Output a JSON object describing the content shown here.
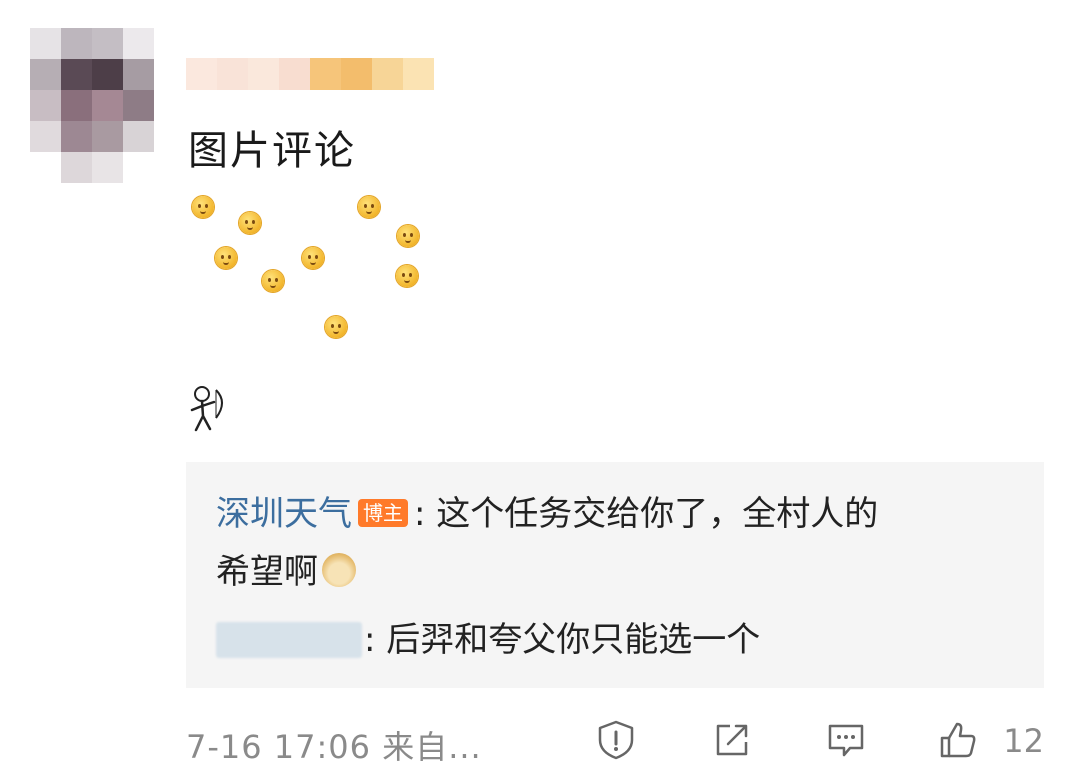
{
  "comment": {
    "text": "图片评论",
    "emoji_icon": "smile-face-icon",
    "sticker_icon": "archer-sticker-icon"
  },
  "reply": {
    "author": "深圳天气",
    "badge": "博主",
    "author_text": ": 这个任务交给你了，全村人的",
    "author_text_line2": "希望啊",
    "reply_text": ": 后羿和夸父你只能选一个"
  },
  "footer": {
    "timestamp": "7-16 17:06 来自...",
    "like_count": "12",
    "icons": [
      "report-icon",
      "share-icon",
      "comment-icon",
      "like-icon"
    ]
  },
  "colors": {
    "author_link": "#3c6e9f",
    "badge_bg": "#ff7a2a",
    "reply_bg": "#f5f5f5",
    "meta_text": "#8a8a8a"
  }
}
